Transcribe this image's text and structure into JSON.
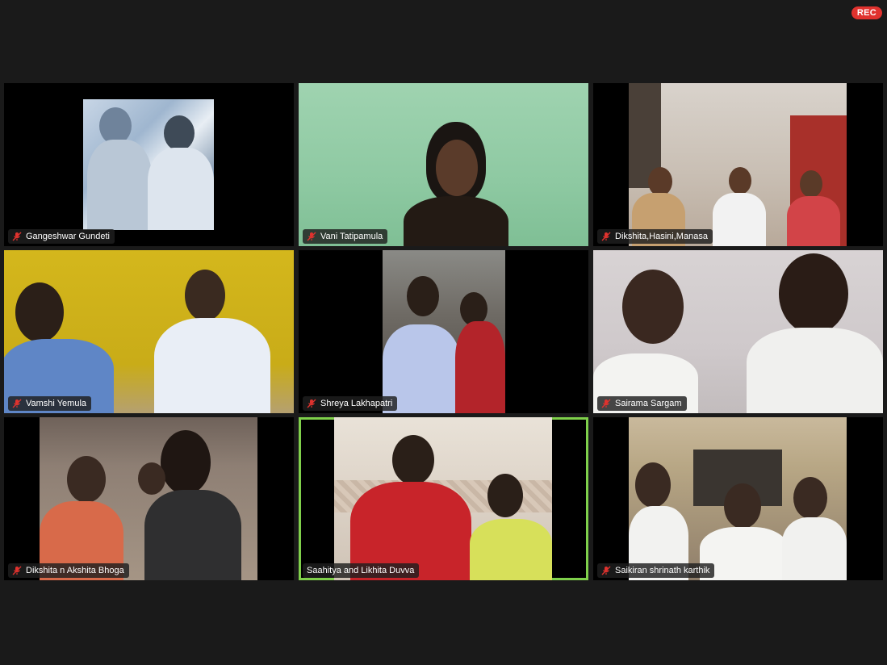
{
  "recording": {
    "label": "REC"
  },
  "participants": [
    {
      "name": "Gangeshwar Gundeti",
      "muted": true,
      "active": false
    },
    {
      "name": "Vani Tatipamula",
      "muted": true,
      "active": false
    },
    {
      "name": "Dikshita,Hasini,Manasa",
      "muted": true,
      "active": false
    },
    {
      "name": "Vamshi Yemula",
      "muted": true,
      "active": false
    },
    {
      "name": "Shreya Lakhapatri",
      "muted": true,
      "active": false
    },
    {
      "name": "Sairama Sargam",
      "muted": true,
      "active": false
    },
    {
      "name": "Dikshita n Akshita Bhoga",
      "muted": true,
      "active": false
    },
    {
      "name": "Saahitya and Likhita Duvva",
      "muted": false,
      "active": true
    },
    {
      "name": "Saikiran shrinath karthik",
      "muted": true,
      "active": false
    }
  ],
  "colors": {
    "background": "#1a1a1a",
    "active_border": "#7fd04b",
    "muted_icon": "#e0322e",
    "rec_badge": "#e0322e"
  }
}
